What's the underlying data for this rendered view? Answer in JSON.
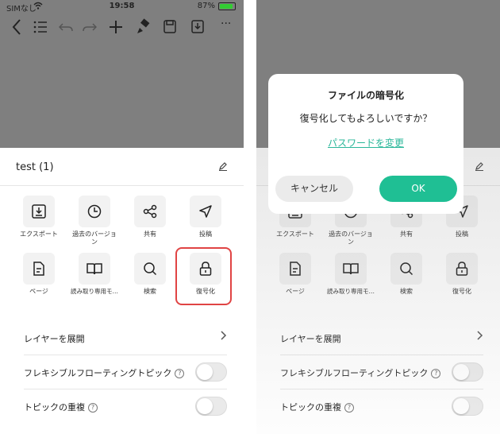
{
  "status": {
    "carrier": "SIMなし",
    "time": "19:58",
    "battery": "87%"
  },
  "toolbar": {
    "icons": [
      "back-icon",
      "outline-icon",
      "undo-icon",
      "redo-icon",
      "add-icon",
      "format-brush-icon",
      "save-icon",
      "download-icon",
      "more-icon"
    ],
    "more": "···"
  },
  "sheet": {
    "title": "test (1)",
    "grid": [
      {
        "label": "エクスポート",
        "icon": "export-icon"
      },
      {
        "label": "過去のバージョン",
        "icon": "history-icon"
      },
      {
        "label": "共有",
        "icon": "share-icon"
      },
      {
        "label": "投稿",
        "icon": "send-icon"
      },
      {
        "label": "ページ",
        "icon": "page-icon"
      },
      {
        "label": "読み取り専用モ…",
        "icon": "book-icon"
      },
      {
        "label": "検索",
        "icon": "search-icon"
      },
      {
        "label": "復号化",
        "icon": "lock-icon"
      }
    ],
    "rows": {
      "expand_layers": "レイヤーを展開",
      "flexible_topic": "フレキシブルフローティングトピック",
      "overlap_topic": "トピックの重複"
    },
    "qmark": "?"
  },
  "dialog": {
    "title": "ファイルの暗号化",
    "message": "復号化してもよろしいですか？",
    "link": "パスワードを変更",
    "cancel": "キャンセル",
    "ok": "OK"
  },
  "colors": {
    "accent": "#1fbf94",
    "link": "#2bb79a",
    "highlight": "#e04444",
    "dim": "#7f7f7f"
  }
}
